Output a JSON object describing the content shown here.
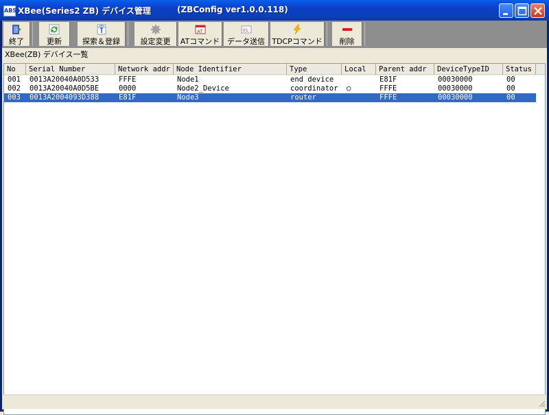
{
  "window": {
    "title": "XBee(Series2 ZB) デバイス管理",
    "subtitle": "(ZBConfig ver1.0.0.118)",
    "icon_text": "ABS"
  },
  "toolbar": {
    "buttons": [
      {
        "label": "終了",
        "icon": "exit-door-icon"
      },
      {
        "label": "更新",
        "icon": "refresh-icon"
      },
      {
        "label": "探索＆登録",
        "icon": "search-register-icon"
      },
      {
        "label": "設定変更",
        "icon": "gear-icon"
      },
      {
        "label": "ATコマンド",
        "icon": "at-command-icon"
      },
      {
        "label": "データ送信",
        "icon": "send-data-icon"
      },
      {
        "label": "TDCPコマンド",
        "icon": "lightning-icon"
      },
      {
        "label": "削除",
        "icon": "delete-icon"
      }
    ]
  },
  "list": {
    "title": "XBee(ZB) デバイス一覧",
    "columns": [
      "No",
      "Serial Number",
      "Network addr",
      "Node Identifier",
      "Type",
      "Local",
      "Parent addr",
      "DeviceTypeID",
      "Status"
    ],
    "rows": [
      [
        "001",
        "0013A20040A0D533",
        "FFFE",
        "Node1",
        "end device",
        "",
        "E81F",
        "00030000",
        "00"
      ],
      [
        "002",
        "0013A20040A0D5BE",
        "0000",
        "Node2_Device",
        "coordinator",
        "○",
        "FFFE",
        "00030000",
        "00"
      ],
      [
        "003",
        "0013A2004093D388",
        "E81F",
        "Node3",
        "router",
        "",
        "FFFE",
        "00030000",
        "00"
      ]
    ],
    "selected_row": 2
  },
  "colors": {
    "titlebar": "#0B3FC6",
    "selection": "#316AC5",
    "toolbar_bg": "#8E8E8E"
  }
}
